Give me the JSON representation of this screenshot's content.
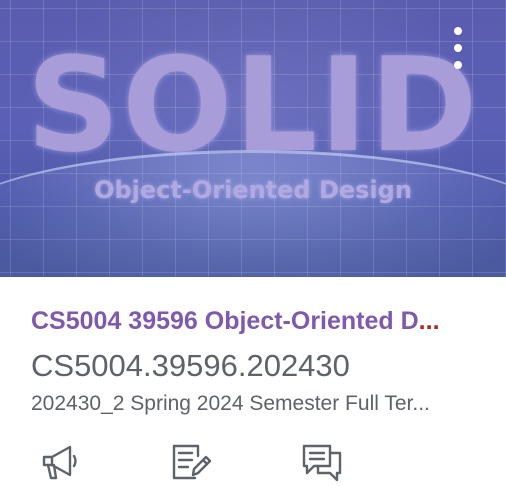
{
  "hero": {
    "title": "SOLID",
    "subtitle": "Object-Oriented Design"
  },
  "course": {
    "name": "CS5004 39596 Object-Oriented D",
    "name_ellipsis": "...",
    "code": "CS5004.39596.202430",
    "term": "202430_2 Spring 2024 Semester Full Ter..."
  },
  "icons": {
    "menu": "more-options-icon",
    "announcements": "megaphone-icon",
    "assignments": "assignment-edit-icon",
    "discussions": "discussion-bubbles-icon"
  },
  "colors": {
    "course_name": "#7f59b0",
    "text": "#5d6368",
    "icon": "#5d6368"
  }
}
